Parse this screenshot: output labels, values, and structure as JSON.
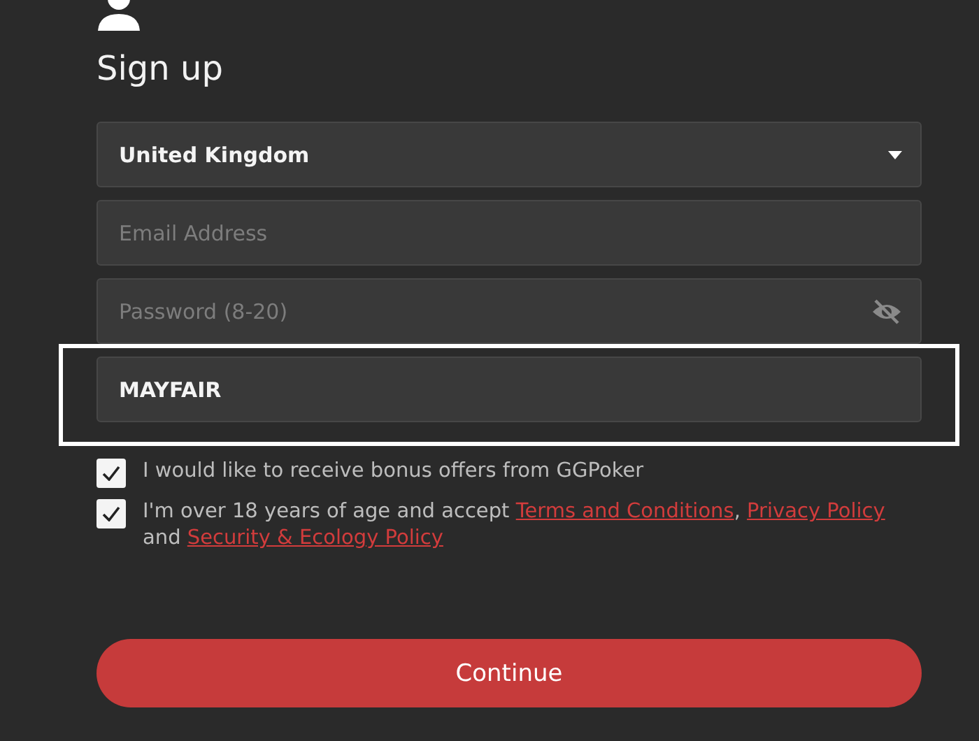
{
  "title": "Sign up",
  "fields": [
    {
      "kind": "select",
      "value": "United Kingdom",
      "highlighted": false
    },
    {
      "kind": "text",
      "placeholder": "Email Address",
      "highlighted": false
    },
    {
      "kind": "password",
      "placeholder": "Password (8-20)",
      "highlighted": false
    },
    {
      "kind": "text",
      "value": "MAYFAIR",
      "highlighted": true
    }
  ],
  "consents": [
    {
      "checked": true,
      "parts": [
        {
          "kind": "text",
          "text": "I would like to receive bonus offers from GGPoker"
        }
      ]
    },
    {
      "checked": true,
      "parts": [
        {
          "kind": "text",
          "text": "I'm over 18 years of age and accept "
        },
        {
          "kind": "link",
          "text": "Terms and Conditions"
        },
        {
          "kind": "text",
          "text": ", "
        },
        {
          "kind": "link",
          "text": "Privacy Policy"
        },
        {
          "kind": "text",
          "text": " and "
        },
        {
          "kind": "link",
          "text": "Security & Ecology Policy"
        }
      ]
    }
  ],
  "button": "Continue"
}
